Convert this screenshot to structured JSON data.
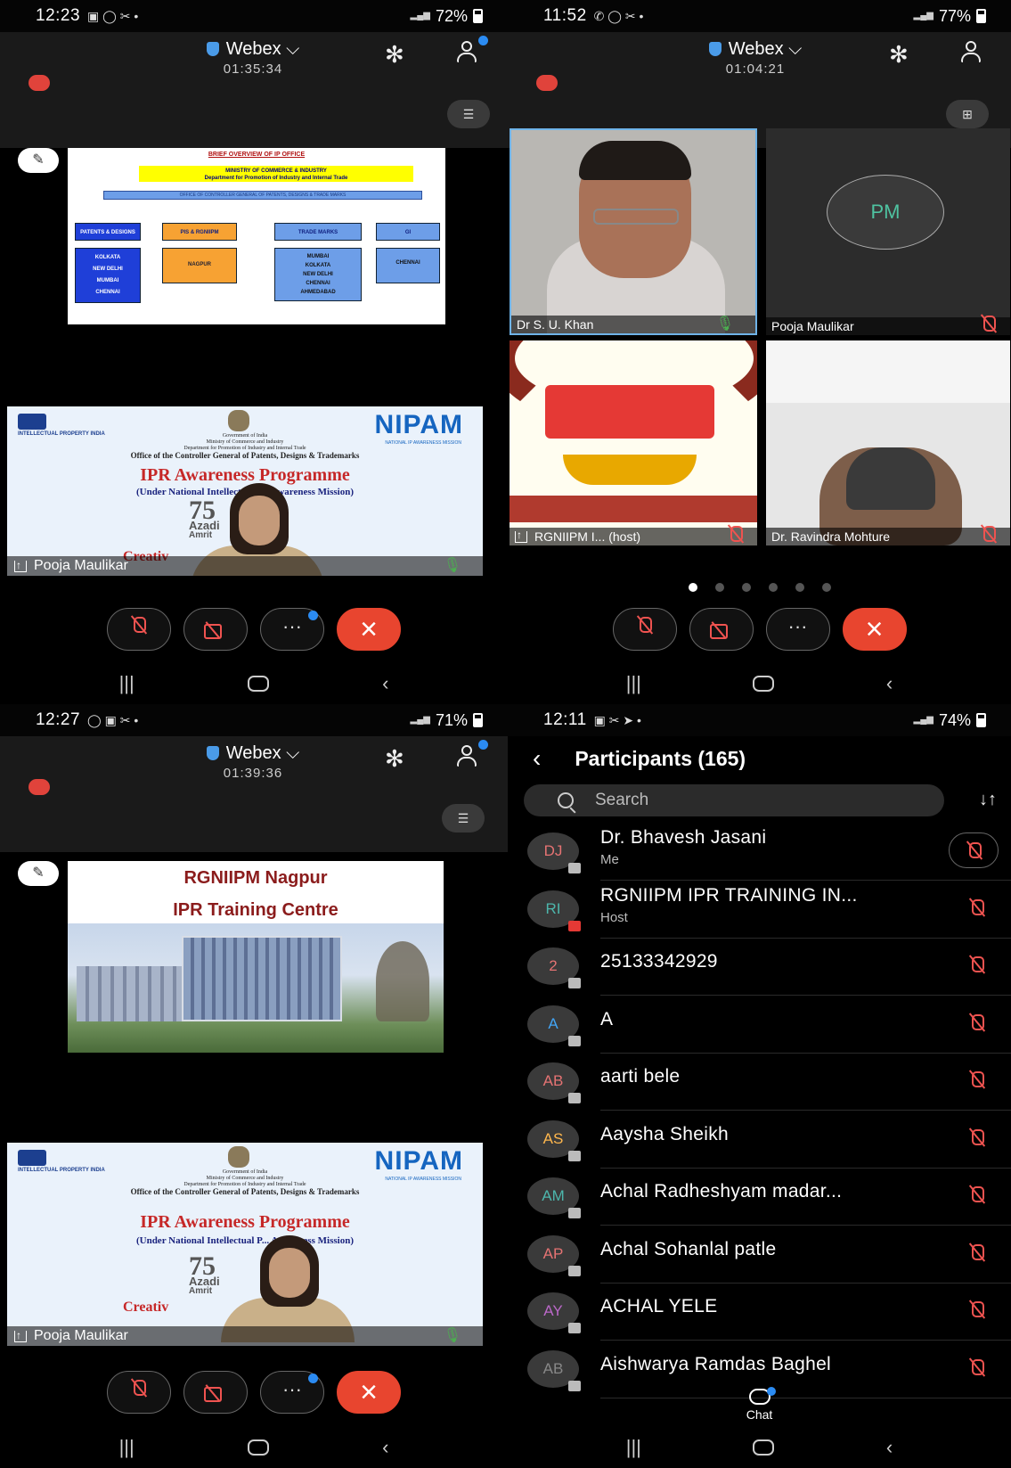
{
  "colors": {
    "accent": "#2b8bf2",
    "end_call": "#e8452f",
    "muted_red": "#ef5350",
    "unmuted_green": "#4caf50"
  },
  "q1": {
    "status": {
      "time": "12:23",
      "battery": "72%"
    },
    "meeting": {
      "app": "Webex",
      "duration": "01:35:34"
    },
    "slide": {
      "title": "BRIEF OVERVIEW OF IP OFFICE",
      "ministry": "MINISTRY OF COMMERCE & INDUSTRY",
      "dept": "Department for Promotion of Industry and Internal Trade",
      "office": "OFFICE OF CONTROLLER GENERAL OF PATENTS, DESIGNS & TRADE MARKS",
      "columns": [
        {
          "head": "PATENTS & DESIGNS",
          "body": [
            "KOLKATA",
            "NEW DELHI",
            "MUMBAI",
            "CHENNAI"
          ]
        },
        {
          "head": "PIS & RGNIIPM",
          "body": [
            "NAGPUR"
          ]
        },
        {
          "head": "TRADE MARKS",
          "body": [
            "MUMBAI",
            "KOLKATA",
            "NEW DELHI",
            "CHENNAI",
            "AHMEDABAD"
          ]
        },
        {
          "head": "GI",
          "body": [
            "CHENNAI"
          ]
        }
      ]
    },
    "banner": {
      "logo": "INTELLECTUAL PROPERTY INDIA",
      "gov": "Government of India",
      "ministry": "Ministry of Commerce and Industry",
      "dept": "Department for Promotion of Industry and Internal Trade",
      "office": "Office of the Controller General of Patents, Designs & Trademarks",
      "nipam": "NIPAM",
      "nipam_sub": "NATIONAL IP AWARENESS MISSION",
      "title": "IPR Awareness Programme",
      "subtitle": "(Under National Intellectual P... Awareness Mission)",
      "azadi_num": "75",
      "azadi": "Azadi",
      "amrit": "Amrit",
      "creative": "Creativ"
    },
    "speaker": "Pooja Maulikar"
  },
  "q2": {
    "status": {
      "time": "11:52",
      "battery": "77%"
    },
    "meeting": {
      "app": "Webex",
      "duration": "01:04:21"
    },
    "tiles": [
      {
        "name": "Dr S. U. Khan",
        "mic": "on"
      },
      {
        "name": "Pooja Maulikar",
        "initials": "PM",
        "mic": "off"
      },
      {
        "name": "RGNIIPM I... (host)",
        "mic": "off"
      },
      {
        "name": "Dr. Ravindra Mohture",
        "mic": "off"
      }
    ]
  },
  "q3": {
    "status": {
      "time": "12:27",
      "battery": "71%"
    },
    "meeting": {
      "app": "Webex",
      "duration": "01:39:36"
    },
    "slide": {
      "line1": "RGNIIPM Nagpur",
      "line2": "IPR Training Centre"
    },
    "speaker": "Pooja Maulikar"
  },
  "q4": {
    "status": {
      "time": "12:11",
      "battery": "74%"
    },
    "title": "Participants (165)",
    "search_placeholder": "Search",
    "participants": [
      {
        "initials": "DJ",
        "name": "Dr. Bhavesh Jasani",
        "role": "Me",
        "color": "#e57373"
      },
      {
        "initials": "RI",
        "name": "RGNIIPM IPR TRAINING IN...",
        "role": "Host",
        "color": "#4db6ac"
      },
      {
        "initials": "2",
        "name": "25133342929",
        "role": "",
        "color": "#e57373"
      },
      {
        "initials": "A",
        "name": "A",
        "role": "",
        "color": "#42a5f5"
      },
      {
        "initials": "AB",
        "name": "aarti bele",
        "role": "",
        "color": "#e57373"
      },
      {
        "initials": "AS",
        "name": "Aaysha Sheikh",
        "role": "",
        "color": "#ffb74d"
      },
      {
        "initials": "AM",
        "name": "Achal Radheshyam madar...",
        "role": "",
        "color": "#4db6ac"
      },
      {
        "initials": "AP",
        "name": "Achal Sohanlal patle",
        "role": "",
        "color": "#e57373"
      },
      {
        "initials": "AY",
        "name": "ACHAL YELE",
        "role": "",
        "color": "#ba68c8"
      },
      {
        "initials": "AB",
        "name": "Aishwarya Ramdas Baghel",
        "role": "",
        "color": "#888888"
      }
    ],
    "chat": "Chat"
  }
}
